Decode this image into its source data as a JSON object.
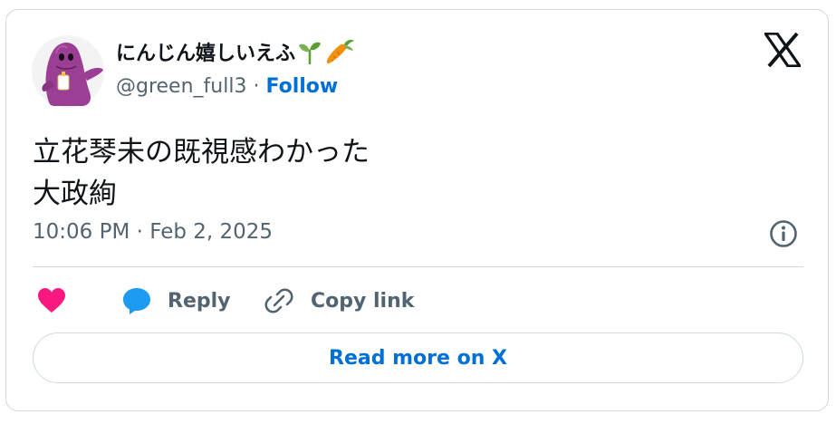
{
  "author": {
    "display_name": "にんじん嬉しいえふ",
    "name_emojis": [
      "seedling-emoji",
      "carrot-emoji"
    ],
    "handle": "@green_full3",
    "separator": "·",
    "follow_label": "Follow"
  },
  "tweet": {
    "lines": [
      "立花琴未の既視感わかった",
      "大政絢"
    ],
    "timestamp": "10:06 PM · Feb 2, 2025"
  },
  "actions": {
    "like_icon": "heart-icon",
    "reply_label": "Reply",
    "reply_icon": "speech-bubble-icon",
    "copy_link_label": "Copy link",
    "copy_link_icon": "link-icon"
  },
  "read_more_label": "Read more on X",
  "icons": {
    "brand": "x-logo-icon",
    "info": "info-icon"
  },
  "colors": {
    "accent": "#006fd6",
    "like": "#f91880",
    "reply_icon": "#1d9bf0",
    "secondary_text": "#536471",
    "border": "#cfd9de",
    "avatar": "#9a3f93"
  }
}
